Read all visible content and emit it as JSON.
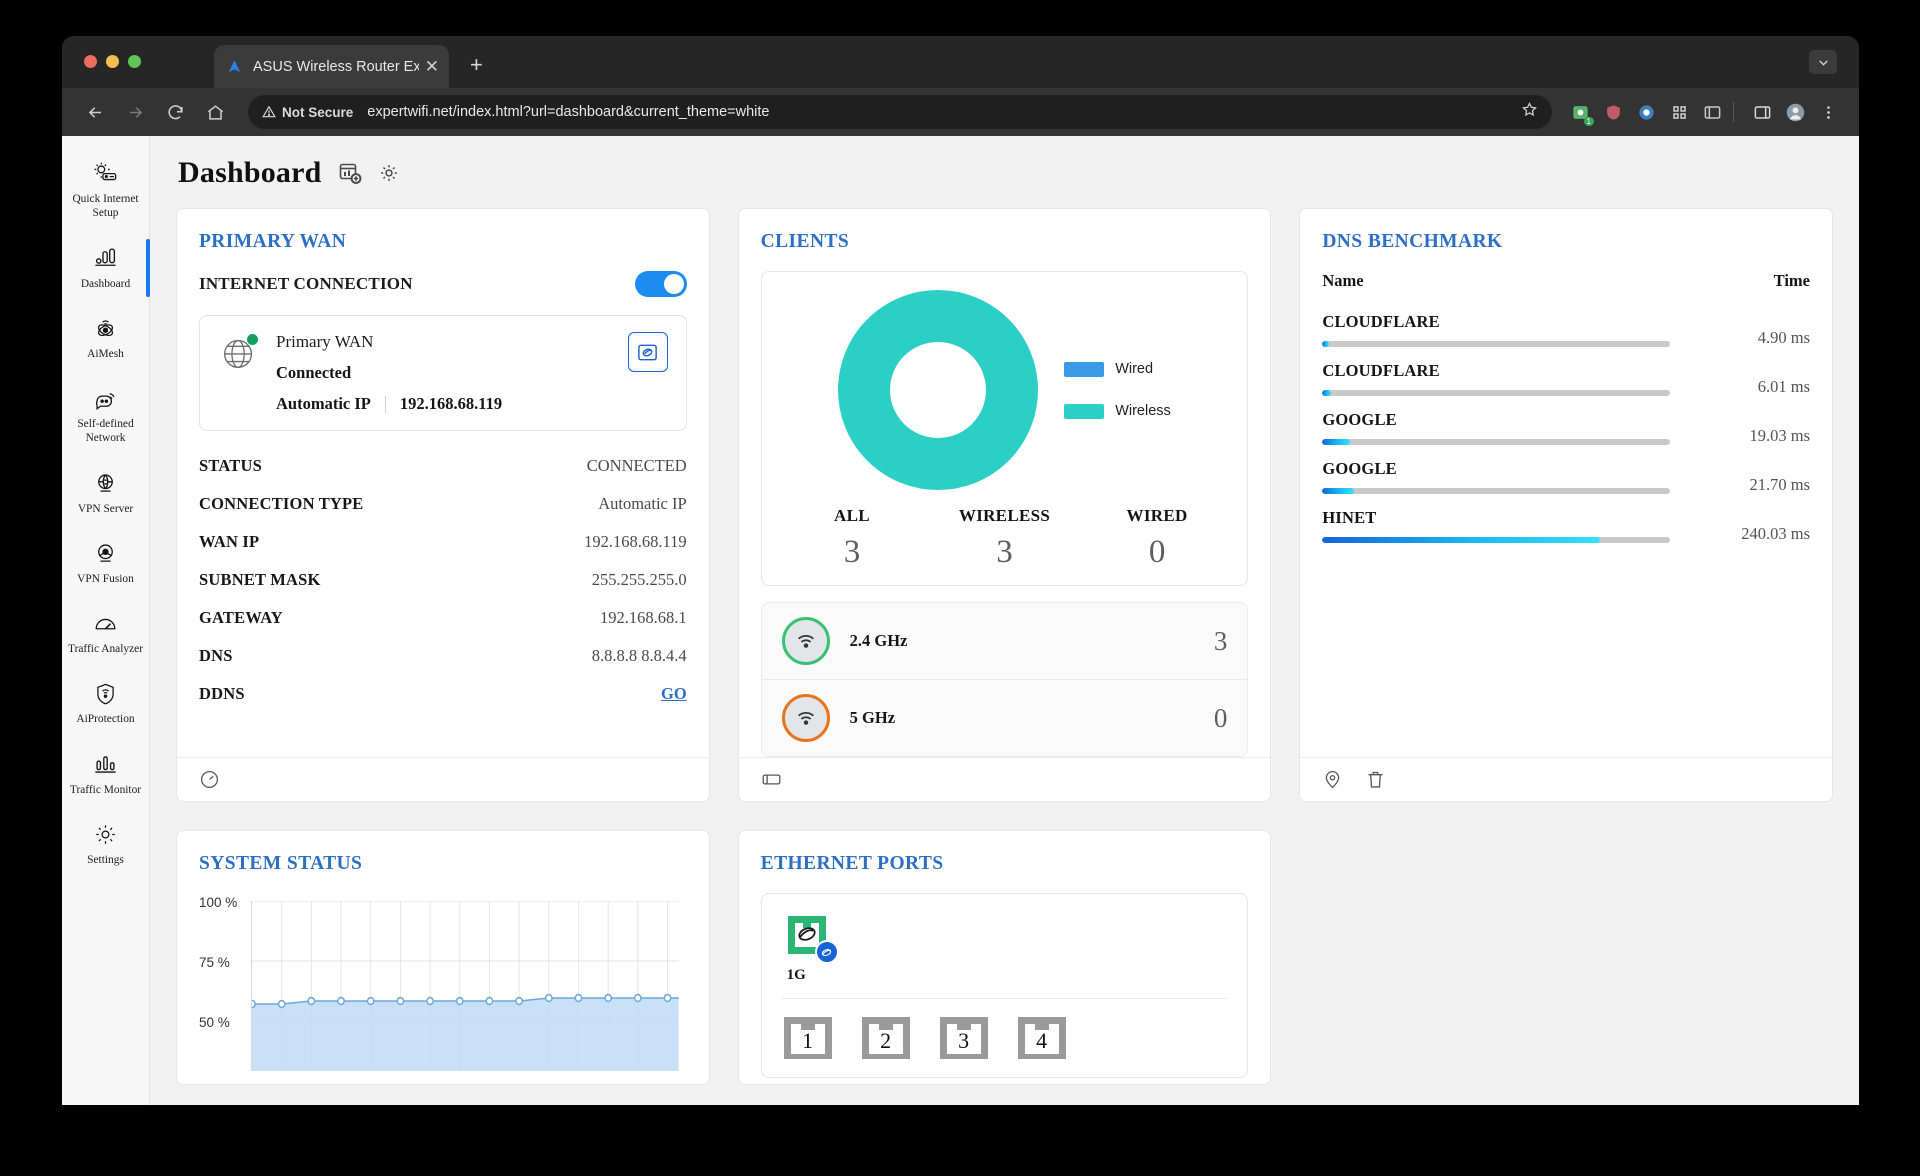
{
  "browser": {
    "tab_title": "ASUS Wireless Router Exper",
    "close_glyph": "✕",
    "new_tab_glyph": "+",
    "security_label": "Not Secure",
    "url": "expertwifi.net/index.html?url=dashboard&current_theme=white",
    "extension_badge": "1"
  },
  "sidebar": {
    "items": [
      {
        "label": "Quick Internet Setup",
        "icon": "quick-internet-setup-icon",
        "active": false
      },
      {
        "label": "Dashboard",
        "icon": "dashboard-icon",
        "active": true
      },
      {
        "label": "AiMesh",
        "icon": "aimesh-icon",
        "active": false
      },
      {
        "label": "Self-defined Network",
        "icon": "self-defined-network-icon",
        "active": false
      },
      {
        "label": "VPN Server",
        "icon": "vpn-server-icon",
        "active": false
      },
      {
        "label": "VPN Fusion",
        "icon": "vpn-fusion-icon",
        "active": false
      },
      {
        "label": "Traffic Analyzer",
        "icon": "traffic-analyzer-icon",
        "active": false
      },
      {
        "label": "AiProtection",
        "icon": "aiprotection-icon",
        "active": false
      },
      {
        "label": "Traffic Monitor",
        "icon": "traffic-monitor-icon",
        "active": false
      },
      {
        "label": "Settings",
        "icon": "settings-icon",
        "active": false
      }
    ]
  },
  "page": {
    "title": "Dashboard",
    "add_widget_icon": "add-widget-icon",
    "settings_icon": "gear-icon"
  },
  "primary_wan": {
    "title": "PRIMARY WAN",
    "internet_connection_label": "INTERNET CONNECTION",
    "toggle_on": true,
    "box": {
      "name": "Primary WAN",
      "state": "Connected",
      "ip_type": "Automatic IP",
      "ip": "192.168.68.119",
      "edit_icon": "wan-edit-icon",
      "status_dot_color": "#12A05A"
    },
    "details": [
      {
        "key": "STATUS",
        "value": "CONNECTED",
        "link": false
      },
      {
        "key": "CONNECTION TYPE",
        "value": "Automatic IP",
        "link": false
      },
      {
        "key": "WAN IP",
        "value": "192.168.68.119",
        "link": false
      },
      {
        "key": "SUBNET MASK",
        "value": "255.255.255.0",
        "link": false
      },
      {
        "key": "GATEWAY",
        "value": "192.168.68.1",
        "link": false
      },
      {
        "key": "DNS",
        "value": "8.8.8.8 8.8.4.4",
        "link": false
      },
      {
        "key": "DDNS",
        "value": "GO",
        "link": true
      }
    ],
    "footer_icon": "speedtest-icon"
  },
  "clients": {
    "title": "CLIENTS",
    "legend": [
      {
        "label": "Wired",
        "color": "#3C9BE8"
      },
      {
        "label": "Wireless",
        "color": "#2CCFC4"
      }
    ],
    "counts": [
      {
        "label": "ALL",
        "value": "3"
      },
      {
        "label": "WIRELESS",
        "value": "3"
      },
      {
        "label": "WIRED",
        "value": "0"
      }
    ],
    "bands": [
      {
        "label": "2.4 GHz",
        "value": "3",
        "ring_color": "#38C172",
        "icon": "wifi-icon"
      },
      {
        "label": "5 GHz",
        "value": "0",
        "ring_color": "#E8741C",
        "icon": "wifi-icon"
      }
    ],
    "footer_icon": "client-list-icon",
    "chart_data": {
      "type": "pie",
      "title": "CLIENTS",
      "labels": [
        "Wired",
        "Wireless"
      ],
      "values": [
        0,
        3
      ],
      "colors": [
        "#3C9BE8",
        "#2CCFC4"
      ],
      "legend": "right",
      "donut": true
    }
  },
  "dns_benchmark": {
    "title": "DNS BENCHMARK",
    "col_name": "Name",
    "col_time": "Time",
    "rows": [
      {
        "name": "CLOUDFLARE",
        "time": "4.90 ms",
        "pct": 2.0
      },
      {
        "name": "CLOUDFLARE",
        "time": "6.01 ms",
        "pct": 2.5
      },
      {
        "name": "GOOGLE",
        "time": "19.03 ms",
        "pct": 7.9
      },
      {
        "name": "GOOGLE",
        "time": "21.70 ms",
        "pct": 9.0
      },
      {
        "name": "HINET",
        "time": "240.03 ms",
        "pct": 80.0
      }
    ],
    "footer_icons": [
      "location-icon",
      "trash-icon"
    ],
    "chart_data": {
      "type": "bar",
      "orientation": "horizontal",
      "title": "DNS BENCHMARK",
      "categories": [
        "CLOUDFLARE",
        "CLOUDFLARE",
        "GOOGLE",
        "GOOGLE",
        "HINET"
      ],
      "values": [
        4.9,
        6.01,
        19.03,
        21.7,
        240.03
      ],
      "unit": "ms",
      "xlabel": "Time",
      "ylabel": "Name",
      "xlim": [
        0,
        300
      ]
    }
  },
  "system_status": {
    "title": "SYSTEM STATUS",
    "chart_data": {
      "type": "area",
      "title": "SYSTEM STATUS",
      "ylabel": "",
      "xlabel": "",
      "ylim": [
        0,
        100
      ],
      "ytick_labels": [
        "100 %",
        "75 %",
        "50 %"
      ],
      "yticks": [
        100,
        75,
        50
      ],
      "x": [
        1,
        2,
        3,
        4,
        5,
        6,
        7,
        8,
        9,
        10,
        11,
        12,
        13,
        14,
        15,
        16,
        17
      ],
      "values": [
        57,
        57,
        58,
        58,
        58,
        58,
        58,
        58,
        58,
        58,
        59,
        59,
        59,
        59,
        59,
        59,
        59
      ],
      "line_color": "#6FA8DC",
      "fill_color": "#BEDCF5",
      "grid": true
    }
  },
  "ethernet_ports": {
    "title": "ETHERNET PORTS",
    "wan_port": {
      "speed": "1G",
      "icon": "ethernet-port-icon",
      "badge_icon": "internet-icon",
      "color": "#2BB673"
    },
    "lan_ports": [
      {
        "label": "1"
      },
      {
        "label": "2"
      },
      {
        "label": "3"
      },
      {
        "label": "4"
      }
    ]
  }
}
